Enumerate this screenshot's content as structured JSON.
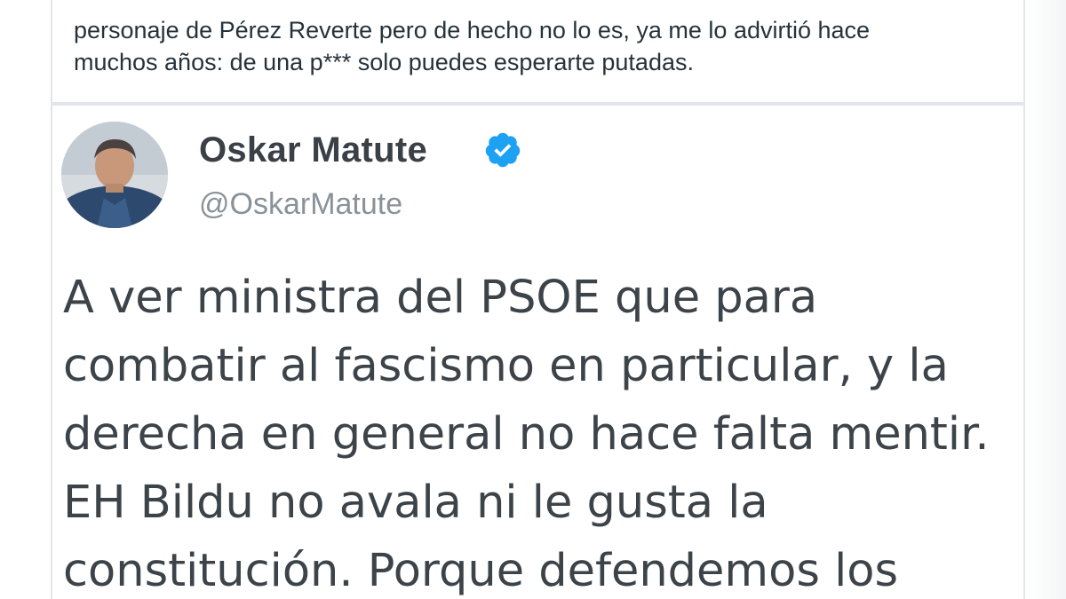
{
  "top_quote": {
    "lines": [
      "personaje de Pérez Reverte pero de hecho no lo es, ya me lo advirtió hace",
      "muchos años: de una p*** solo puedes esperarte putadas."
    ]
  },
  "tweet": {
    "author_name": "Oskar Matute",
    "author_handle": "@OskarMatute",
    "verified_icon": "verified-badge-icon",
    "avatar_icon": "avatar-photo",
    "body_lines": [
      "A ver ministra del PSOE que para",
      "combatir al fascismo en particular, y la",
      "derecha en general no hace falta mentir.",
      "EH Bildu no avala ni le gusta la",
      "constitución. Porque defendemos los"
    ]
  },
  "colors": {
    "verified_blue": "#1da1f2",
    "name_text": "#3a4046",
    "handle_text": "#8a9299",
    "body_text": "#3c4349",
    "border": "#e3e6e8"
  }
}
